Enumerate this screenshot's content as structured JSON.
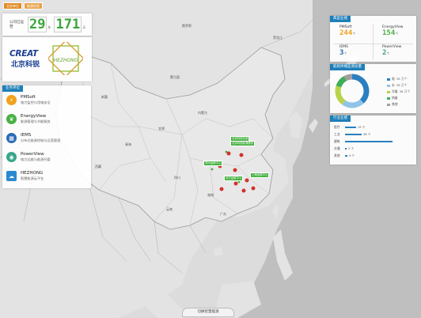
{
  "header": {
    "tabs": [
      {
        "label": "业务单位"
      },
      {
        "label": "能源信息"
      }
    ]
  },
  "days": {
    "label": "公司已运营",
    "value1": "29",
    "unit1": "年",
    "value2": "171",
    "unit2": "天"
  },
  "logo": {
    "creat_text": "CREAT",
    "creat_cn": "北京科锐",
    "hezhong_text": "HEZHONG"
  },
  "business": {
    "title": "业务单位",
    "items": [
      {
        "name": "PMSoft",
        "desc": "电力监控与用电安全",
        "color": "#f0a21d",
        "icon": "lightning-icon"
      },
      {
        "name": "EnergyView",
        "desc": "能源管理与节能服务",
        "color": "#4bb046",
        "icon": "leaf-icon"
      },
      {
        "name": "IEMS",
        "desc": "分布式能源控制与运营管理",
        "color": "#2a6bb6",
        "icon": "grid-icon"
      },
      {
        "name": "PowerView",
        "desc": "电力运维与能源托管",
        "color": "#38a68a",
        "icon": "eye-icon"
      },
      {
        "name": "HEZHONG",
        "desc": "智慧能源云平台",
        "color": "#2a8ad0",
        "icon": "cloud-icon"
      }
    ]
  },
  "typical": {
    "title": "典型业绩",
    "cells": [
      {
        "name": "PMSoft",
        "value": "244",
        "unit": "个"
      },
      {
        "name": "EnergyView",
        "value": "154",
        "unit": "个"
      },
      {
        "name": "IEMS",
        "value": "3",
        "unit": "个"
      },
      {
        "name": "PowerView",
        "value": "2",
        "unit": "个"
      }
    ]
  },
  "pie": {
    "title": "能耗终端监测总量",
    "legend": [
      {
        "label": "电",
        "value": "38 万个",
        "color": "#2a7fbf"
      },
      {
        "label": "水",
        "value": "38 万个",
        "color": "#8fc4e8"
      },
      {
        "label": "冷量",
        "value": "38 万个",
        "color": "#b9d34a"
      },
      {
        "label": "热量",
        "value": "",
        "color": "#3fae5a"
      },
      {
        "label": "其他",
        "value": "",
        "color": "#a0a0a0"
      }
    ],
    "slices": [
      {
        "label": "电",
        "value": 38,
        "color": "#2a7fbf"
      },
      {
        "label": "水",
        "value": 22,
        "color": "#8fc4e8"
      },
      {
        "label": "冷量",
        "value": 20,
        "color": "#b9d34a"
      },
      {
        "label": "热量",
        "value": 12,
        "color": "#3fae5a"
      },
      {
        "label": "其他",
        "value": 8,
        "color": "#a0a0a0"
      }
    ]
  },
  "industry": {
    "title": "行业业绩",
    "rows": [
      {
        "label": "医疗",
        "value": "19 个",
        "fraction": 0.2,
        "color": "#2a7fbf"
      },
      {
        "label": "工业",
        "value": "38 个",
        "fraction": 0.3,
        "color": "#2a7fbf"
      },
      {
        "label": "建筑",
        "value": "",
        "fraction": 0.85,
        "color": "#2a7fbf"
      },
      {
        "label": "交通",
        "value": "2 个",
        "fraction": 0.02,
        "color": "#2a7fbf"
      },
      {
        "label": "其他",
        "value": "4 个",
        "fraction": 0.04,
        "color": "#2a7fbf"
      }
    ]
  },
  "map": {
    "tags": [
      {
        "label": "北京科锐总部"
      },
      {
        "label": "北京科锐能源服务"
      },
      {
        "label": "郑州运维中心"
      },
      {
        "label": "上海运维中心"
      },
      {
        "label": "武汉运维中心"
      }
    ],
    "regions": [
      "新疆",
      "西藏",
      "青海",
      "甘肃",
      "内蒙古",
      "四川",
      "云南",
      "广东",
      "湖南",
      "黑龙江",
      "蒙古国",
      "俄罗斯"
    ]
  },
  "bottom_button": "切换智慧能源"
}
